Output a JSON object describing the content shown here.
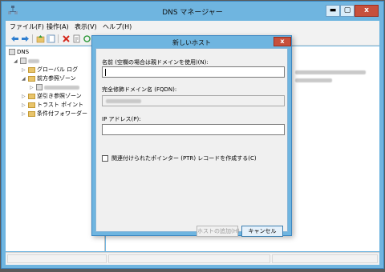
{
  "window": {
    "title": "DNS マネージャー",
    "min_label": "▬",
    "max_label": "▢",
    "close_label": "x"
  },
  "menu": [
    {
      "label": "ファイル(F)"
    },
    {
      "label": "操作(A)"
    },
    {
      "label": "表示(V)"
    },
    {
      "label": "ヘルプ(H)"
    }
  ],
  "tree": {
    "root": "DNS",
    "items": [
      {
        "label": "グローバル ログ"
      },
      {
        "label": "前方参照ゾーン"
      },
      {
        "label": "逆引き参照ゾーン"
      },
      {
        "label": "トラスト ポイント"
      },
      {
        "label": "条件付フォワーダー"
      }
    ]
  },
  "dialog": {
    "title": "新しいホスト",
    "close_label": "x",
    "name_label": "名前 (空欄の場合は親ドメインを使用)(N):",
    "name_value": "",
    "fqdn_label": "完全修飾ドメイン名 (FQDN):",
    "ip_label": "IP アドレス(P):",
    "ip_value": "",
    "ptr_checkbox_label": "関連付けられたポインター (PTR) レコードを作成する(C)",
    "add_host_button": "ホストの追加(H)",
    "cancel_button": "キャンセル"
  },
  "colors": {
    "frame": "#6fb5e0",
    "close": "#c7503c"
  }
}
